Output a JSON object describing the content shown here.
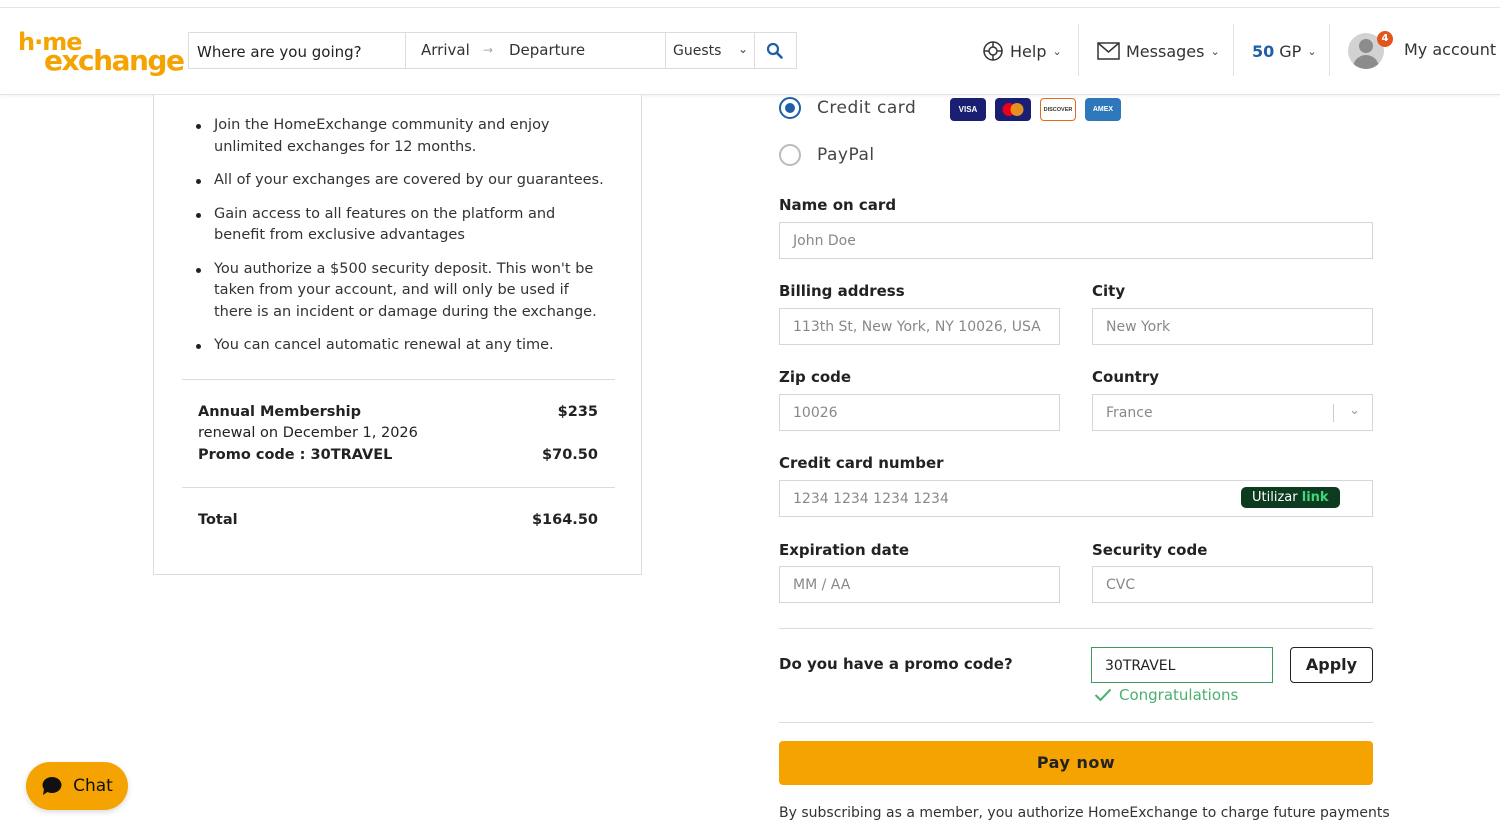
{
  "header": {
    "logo_line1": "h·me",
    "logo_line2": "exchange",
    "search": {
      "where": "Where are you going?",
      "arrival": "Arrival",
      "arrow": "→",
      "departure": "Departure",
      "guests": "Guests"
    },
    "nav": {
      "help": "Help",
      "messages": "Messages",
      "gp_amount": "50",
      "gp_unit": "GP",
      "notification_count": "4",
      "account": "My account"
    }
  },
  "summary": {
    "benefits": [
      "Join the HomeExchange community and enjoy unlimited exchanges for 12 months.",
      "All of your exchanges are covered by our guarantees.",
      "Gain access to all features on the platform and benefit from exclusive advantages",
      "You authorize a $500 security deposit. This won't be taken from your account, and will only be used if there is an incident or damage during the exchange.",
      "You can cancel automatic renewal at any time."
    ],
    "membership_label": "Annual Membership",
    "membership_amount": "$235",
    "renewal": "renewal on December 1, 2026",
    "promo_label": "Promo code : 30TRAVEL",
    "promo_amount": "$70.50",
    "total_label": "Total",
    "total_amount": "$164.50"
  },
  "payment": {
    "credit_card_label": "Credit card",
    "paypal_label": "PayPal",
    "card_brands": [
      "VISA",
      "mastercard",
      "DISCOVER",
      "AMEX"
    ],
    "name_label": "Name on card",
    "name_placeholder": "John Doe",
    "billing_label": "Billing address",
    "billing_placeholder": "113th St, New York, NY 10026, USA",
    "city_label": "City",
    "city_placeholder": "New York",
    "zip_label": "Zip code",
    "zip_placeholder": "10026",
    "country_label": "Country",
    "country_value": "France",
    "cc_label": "Credit card number",
    "cc_placeholder": "1234 1234 1234 1234",
    "link_badge_prefix": "Utilizar",
    "link_badge_brand": "link",
    "exp_label": "Expiration date",
    "exp_placeholder": "MM / AA",
    "sec_label": "Security code",
    "sec_placeholder": "CVC",
    "promo_question": "Do you have a promo code?",
    "promo_value": "30TRAVEL",
    "apply_label": "Apply",
    "congrats": "Congratulations",
    "pay_label": "Pay now",
    "legal": "By subscribing as a member, you authorize HomeExchange to charge future payments"
  },
  "chat": {
    "label": "Chat"
  },
  "colors": {
    "brand_orange": "#f5a300",
    "accent_blue": "#1f5fa8",
    "success_green": "#4caf6e"
  }
}
